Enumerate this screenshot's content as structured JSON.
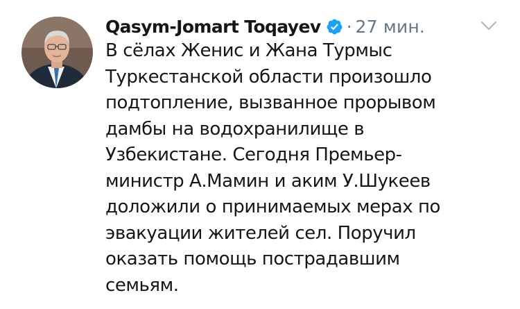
{
  "tweet": {
    "author_name": "Qasym-Jomart Toqayev",
    "verified_icon": "verified-badge-icon",
    "separator": "·",
    "timestamp": "27 мин.",
    "menu_icon": "chevron-down-icon",
    "avatar_icon": "profile-photo",
    "text_lines": [
      "В сёлах Женис и Жана Турмыс",
      "Туркестанской области произошло",
      "подтопление, вызванное прорывом",
      "дамбы на водохранилище в",
      "Узбекистане. Сегодня Премьер-",
      "министр А.Мамин и аким У.Шукеев",
      "доложили о принимаемых мерах по",
      "эвакуации жителей сел. Поручил",
      "оказать помощь пострадавшим",
      "семьям."
    ]
  },
  "colors": {
    "text": "#14171a",
    "secondary_text": "#657786",
    "verified_blue": "#1da1f2",
    "chevron": "#aab8c2"
  }
}
